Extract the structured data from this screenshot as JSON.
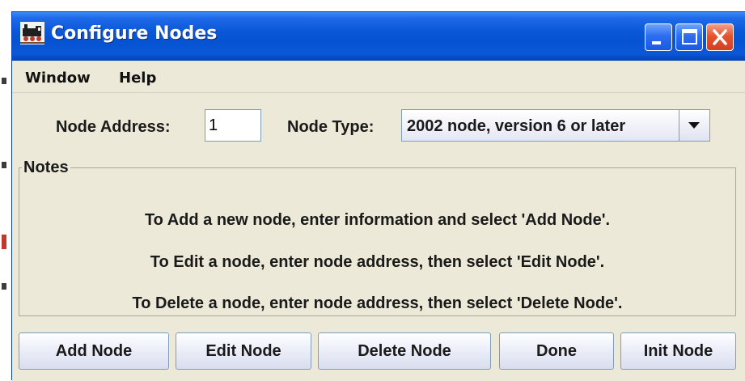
{
  "window": {
    "title": "Configure Nodes"
  },
  "menubar": {
    "items": [
      {
        "label": "Window"
      },
      {
        "label": "Help"
      }
    ]
  },
  "form": {
    "node_address_label": "Node Address:",
    "node_address_value": "1",
    "node_type_label": "Node Type:",
    "node_type_selected": "2002 node, version 6 or later"
  },
  "notes": {
    "title": "Notes",
    "lines": [
      "To Add a new node, enter information and select 'Add Node'.",
      "To Edit a node, enter node address, then select 'Edit Node'.",
      "To Delete a node, enter node address, then select 'Delete Node'."
    ]
  },
  "buttons": {
    "add": "Add Node",
    "edit": "Edit Node",
    "delete": "Delete Node",
    "done": "Done",
    "init": "Init Node"
  },
  "colors": {
    "title_bar": "#0553d2",
    "window_body": "#ece9d8",
    "close_button": "#d2401e",
    "input_border": "#7f9db9"
  },
  "icons": {
    "app": "locomotive-icon",
    "minimize": "minimize-icon",
    "maximize": "maximize-icon",
    "close": "close-icon",
    "dropdown": "chevron-down-icon"
  }
}
